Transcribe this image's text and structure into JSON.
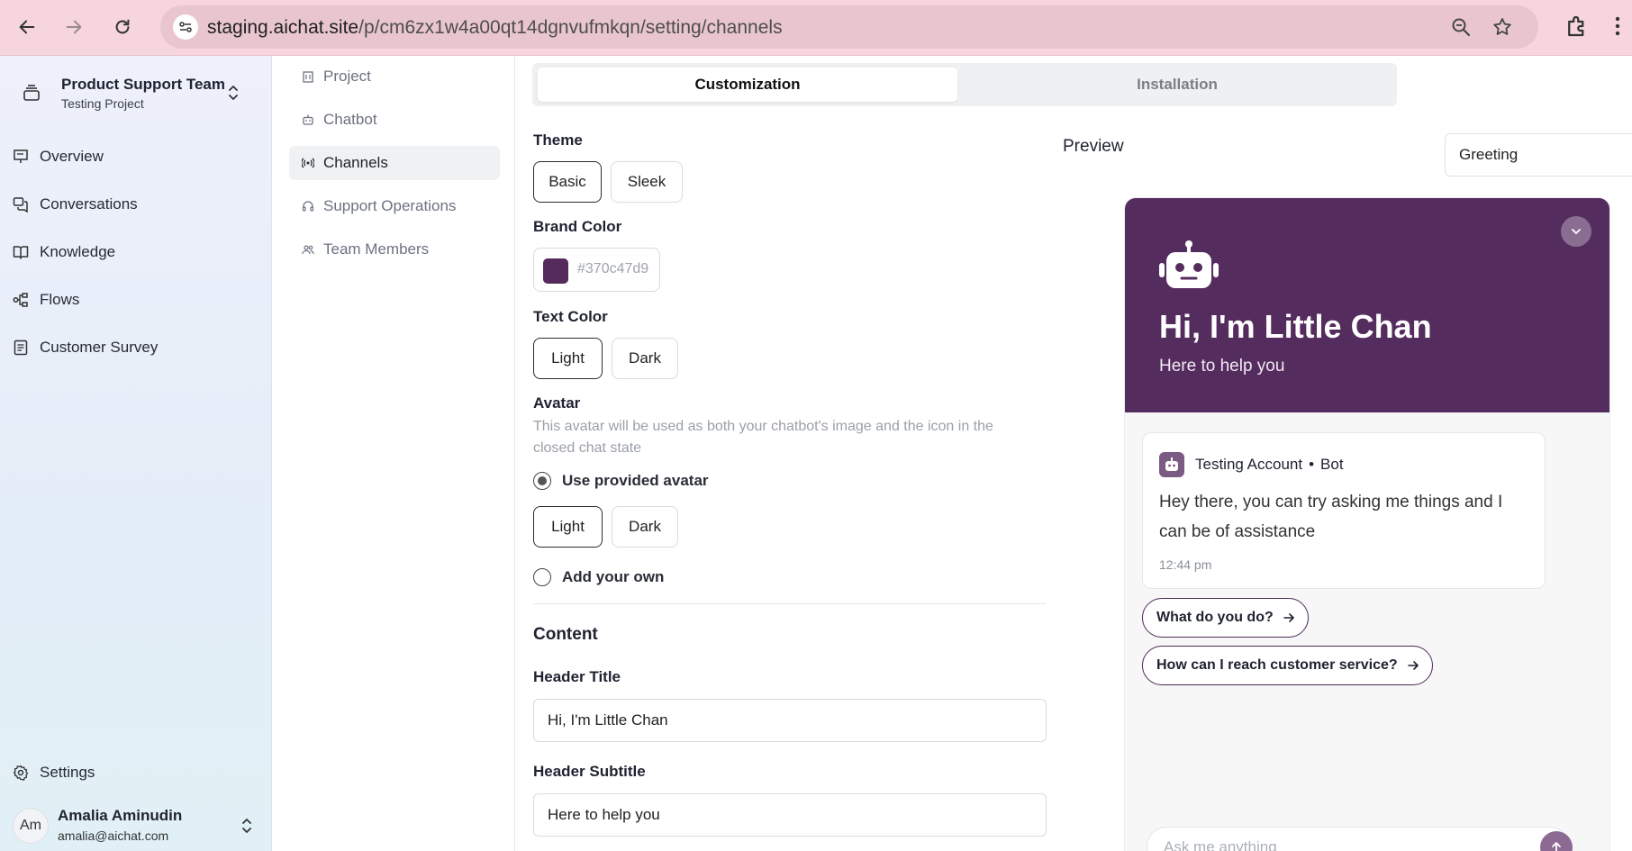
{
  "browser": {
    "url_host": "staging.aichat.site",
    "url_path": "/p/cm6zx1w4a00qt14dgnvufmkqn/setting/channels"
  },
  "sidebar": {
    "team_name": "Product Support Team",
    "project_name": "Testing Project",
    "items": [
      {
        "label": "Overview",
        "icon": "presentation-icon"
      },
      {
        "label": "Conversations",
        "icon": "chat-icon"
      },
      {
        "label": "Knowledge",
        "icon": "book-icon"
      },
      {
        "label": "Flows",
        "icon": "flow-icon"
      },
      {
        "label": "Customer Survey",
        "icon": "survey-icon"
      }
    ],
    "settings_label": "Settings",
    "user": {
      "initials": "Am",
      "name": "Amalia Aminudin",
      "email": "amalia@aichat.com"
    }
  },
  "subnav": {
    "items": [
      {
        "label": "Project",
        "icon": "building-icon"
      },
      {
        "label": "Chatbot",
        "icon": "bot-icon"
      },
      {
        "label": "Channels",
        "icon": "broadcast-icon",
        "active": true
      },
      {
        "label": "Support Operations",
        "icon": "headset-icon"
      },
      {
        "label": "Team Members",
        "icon": "users-icon"
      }
    ]
  },
  "tabs": {
    "customization": "Customization",
    "installation": "Installation",
    "active": "Customization"
  },
  "form": {
    "theme_label": "Theme",
    "theme_options": [
      "Basic",
      "Sleek"
    ],
    "theme_selected": "Basic",
    "brand_color_label": "Brand Color",
    "brand_color_value": "#370c47d9",
    "brand_color_swatch": "#552a5c",
    "text_color_label": "Text Color",
    "text_color_options": [
      "Light",
      "Dark"
    ],
    "text_color_selected": "Light",
    "avatar_label": "Avatar",
    "avatar_help": "This avatar will be used as both your chatbot's image and the icon in the closed chat state",
    "avatar_provided_label": "Use provided avatar",
    "avatar_provided_selected": true,
    "avatar_style_options": [
      "Light",
      "Dark"
    ],
    "avatar_style_selected": "Light",
    "avatar_own_label": "Add your own",
    "content_title": "Content",
    "header_title_label": "Header Title",
    "header_title_value": "Hi, I'm Little Chan",
    "header_subtitle_label": "Header Subtitle",
    "header_subtitle_value": "Here to help you"
  },
  "preview": {
    "label": "Preview",
    "select_value": "Greeting",
    "widget": {
      "title": "Hi, I'm Little Chan",
      "subtitle": "Here to help you",
      "brand_color": "#552c5e",
      "sender_name": "Testing Account",
      "sender_dot": "•",
      "sender_role": "Bot",
      "message": "Hey there, you can try asking me things and I can be of assistance",
      "time": "12:44 pm",
      "suggestions": [
        "What do you do?",
        "How can I reach customer service?"
      ],
      "input_placeholder": "Ask me anything"
    }
  }
}
